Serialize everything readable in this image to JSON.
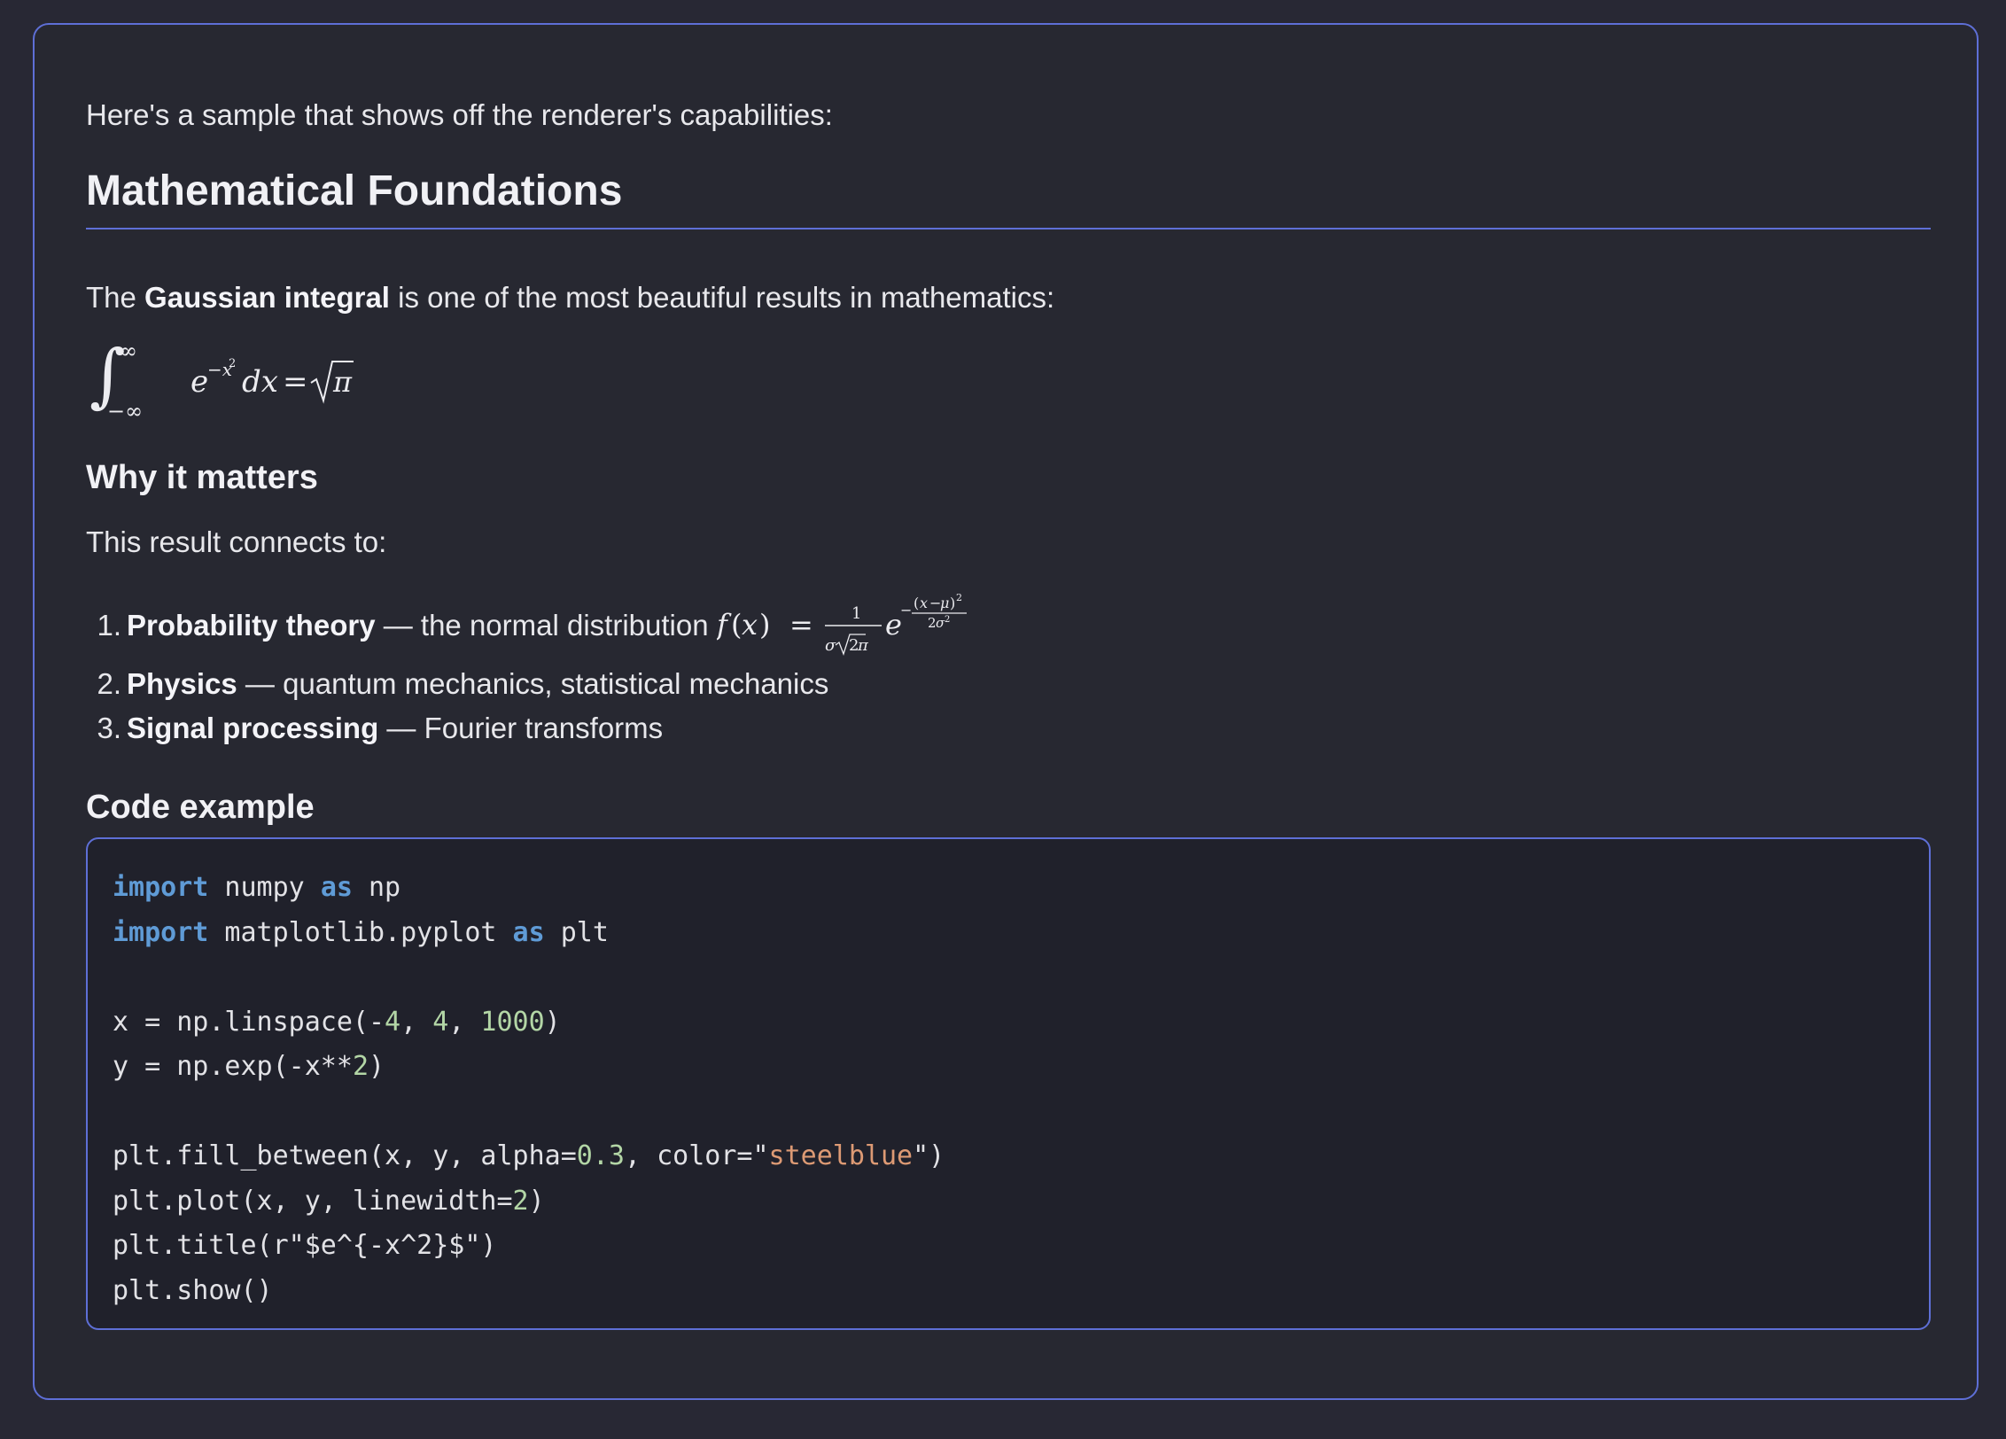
{
  "intro": "Here's a sample that shows off the renderer's capabilities:",
  "heading": "Mathematical Foundations",
  "gaussian": {
    "pre": "The ",
    "bold": "Gaussian integral",
    "post": " is one of the most beautiful results in mathematics:"
  },
  "why_heading": "Why it matters",
  "connects": "This result connects to:",
  "list": [
    {
      "num": "1.",
      "bold": "Probability theory",
      "text": " — the normal distribution "
    },
    {
      "num": "2.",
      "bold": "Physics",
      "text": " — quantum mechanics, statistical mechanics"
    },
    {
      "num": "3.",
      "bold": "Signal processing",
      "text": " — Fourier transforms"
    }
  ],
  "code_heading": "Code example",
  "code_lines": [
    "import numpy as np",
    "import matplotlib.pyplot as plt",
    "",
    "x = np.linspace(-4, 4, 1000)",
    "y = np.exp(-x**2)",
    "",
    "plt.fill_between(x, y, alpha=0.3, color=\"steelblue\")",
    "plt.plot(x, y, linewidth=2)",
    "plt.title(r\"$e^{-x^2}$\")",
    "plt.show()"
  ],
  "colors": {
    "background": "#282834",
    "card": "#272831",
    "accent_border": "#5e6fd6",
    "keyword": "#5f9bd6",
    "number": "#b3d6a6",
    "string": "#dd9a74"
  }
}
